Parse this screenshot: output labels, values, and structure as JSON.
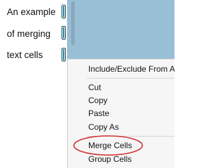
{
  "cells": [
    {
      "text": "An example"
    },
    {
      "text": "of merging"
    },
    {
      "text": "text cells"
    }
  ],
  "context_menu": {
    "items": [
      {
        "label": "Include/Exclude From AI C"
      },
      {
        "label": "Cut"
      },
      {
        "label": "Copy"
      },
      {
        "label": "Paste"
      },
      {
        "label": "Copy As"
      },
      {
        "label": "Merge Cells",
        "highlighted": true
      },
      {
        "label": "Group Cells"
      }
    ]
  },
  "colors": {
    "canvas": "#98bfd6",
    "menu_background": "#f6f6f6",
    "highlight_ellipse": "#d32f2f",
    "handle_accent": "#1a8fa8"
  }
}
